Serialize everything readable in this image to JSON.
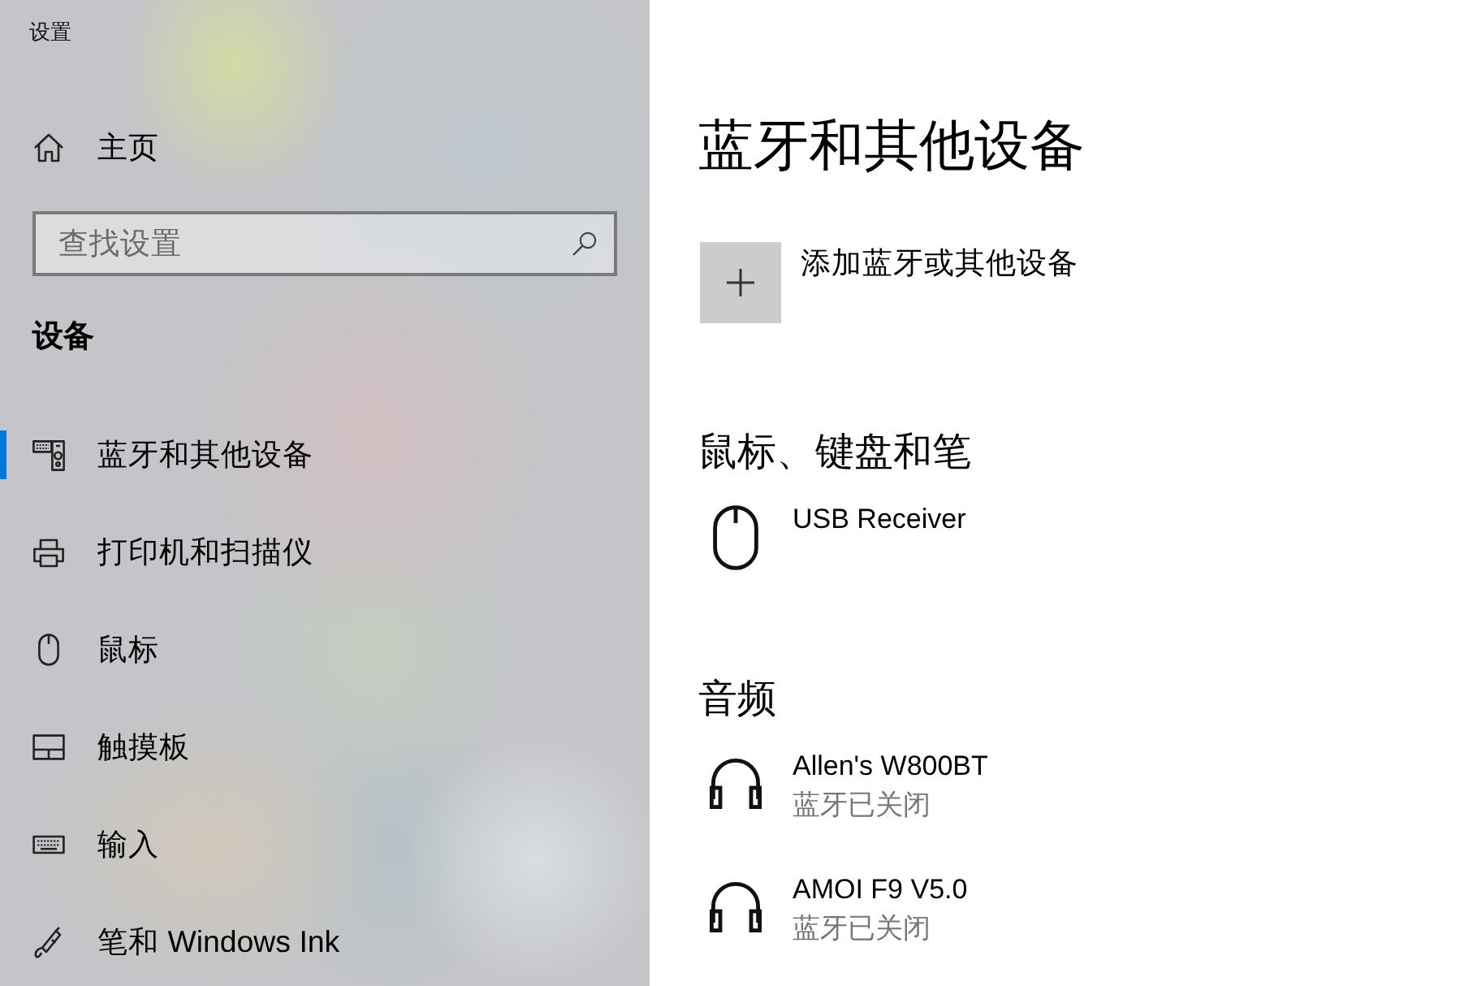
{
  "window": {
    "title": "设置"
  },
  "sidebar": {
    "home": {
      "label": "主页"
    },
    "search": {
      "placeholder": "查找设置"
    },
    "section": "设备",
    "items": [
      {
        "label": "蓝牙和其他设备",
        "kind": "devices",
        "selected": true
      },
      {
        "label": "打印机和扫描仪",
        "kind": "printer",
        "selected": false
      },
      {
        "label": "鼠标",
        "kind": "mouse",
        "selected": false
      },
      {
        "label": "触摸板",
        "kind": "touchpad",
        "selected": false
      },
      {
        "label": "输入",
        "kind": "keyboard",
        "selected": false
      },
      {
        "label": "笔和 Windows Ink",
        "kind": "pen",
        "selected": false
      }
    ]
  },
  "content": {
    "title": "蓝牙和其他设备",
    "add_device": {
      "label": "添加蓝牙或其他设备"
    },
    "groups": [
      {
        "heading": "鼠标、键盘和笔",
        "devices": [
          {
            "name": "USB Receiver",
            "kind": "mouse"
          }
        ]
      },
      {
        "heading": "音频",
        "devices": [
          {
            "name": "Allen's W800BT",
            "status": "蓝牙已关闭",
            "kind": "headphones"
          },
          {
            "name": "AMOI F9 V5.0",
            "status": "蓝牙已关闭",
            "kind": "headphones"
          }
        ]
      }
    ]
  }
}
